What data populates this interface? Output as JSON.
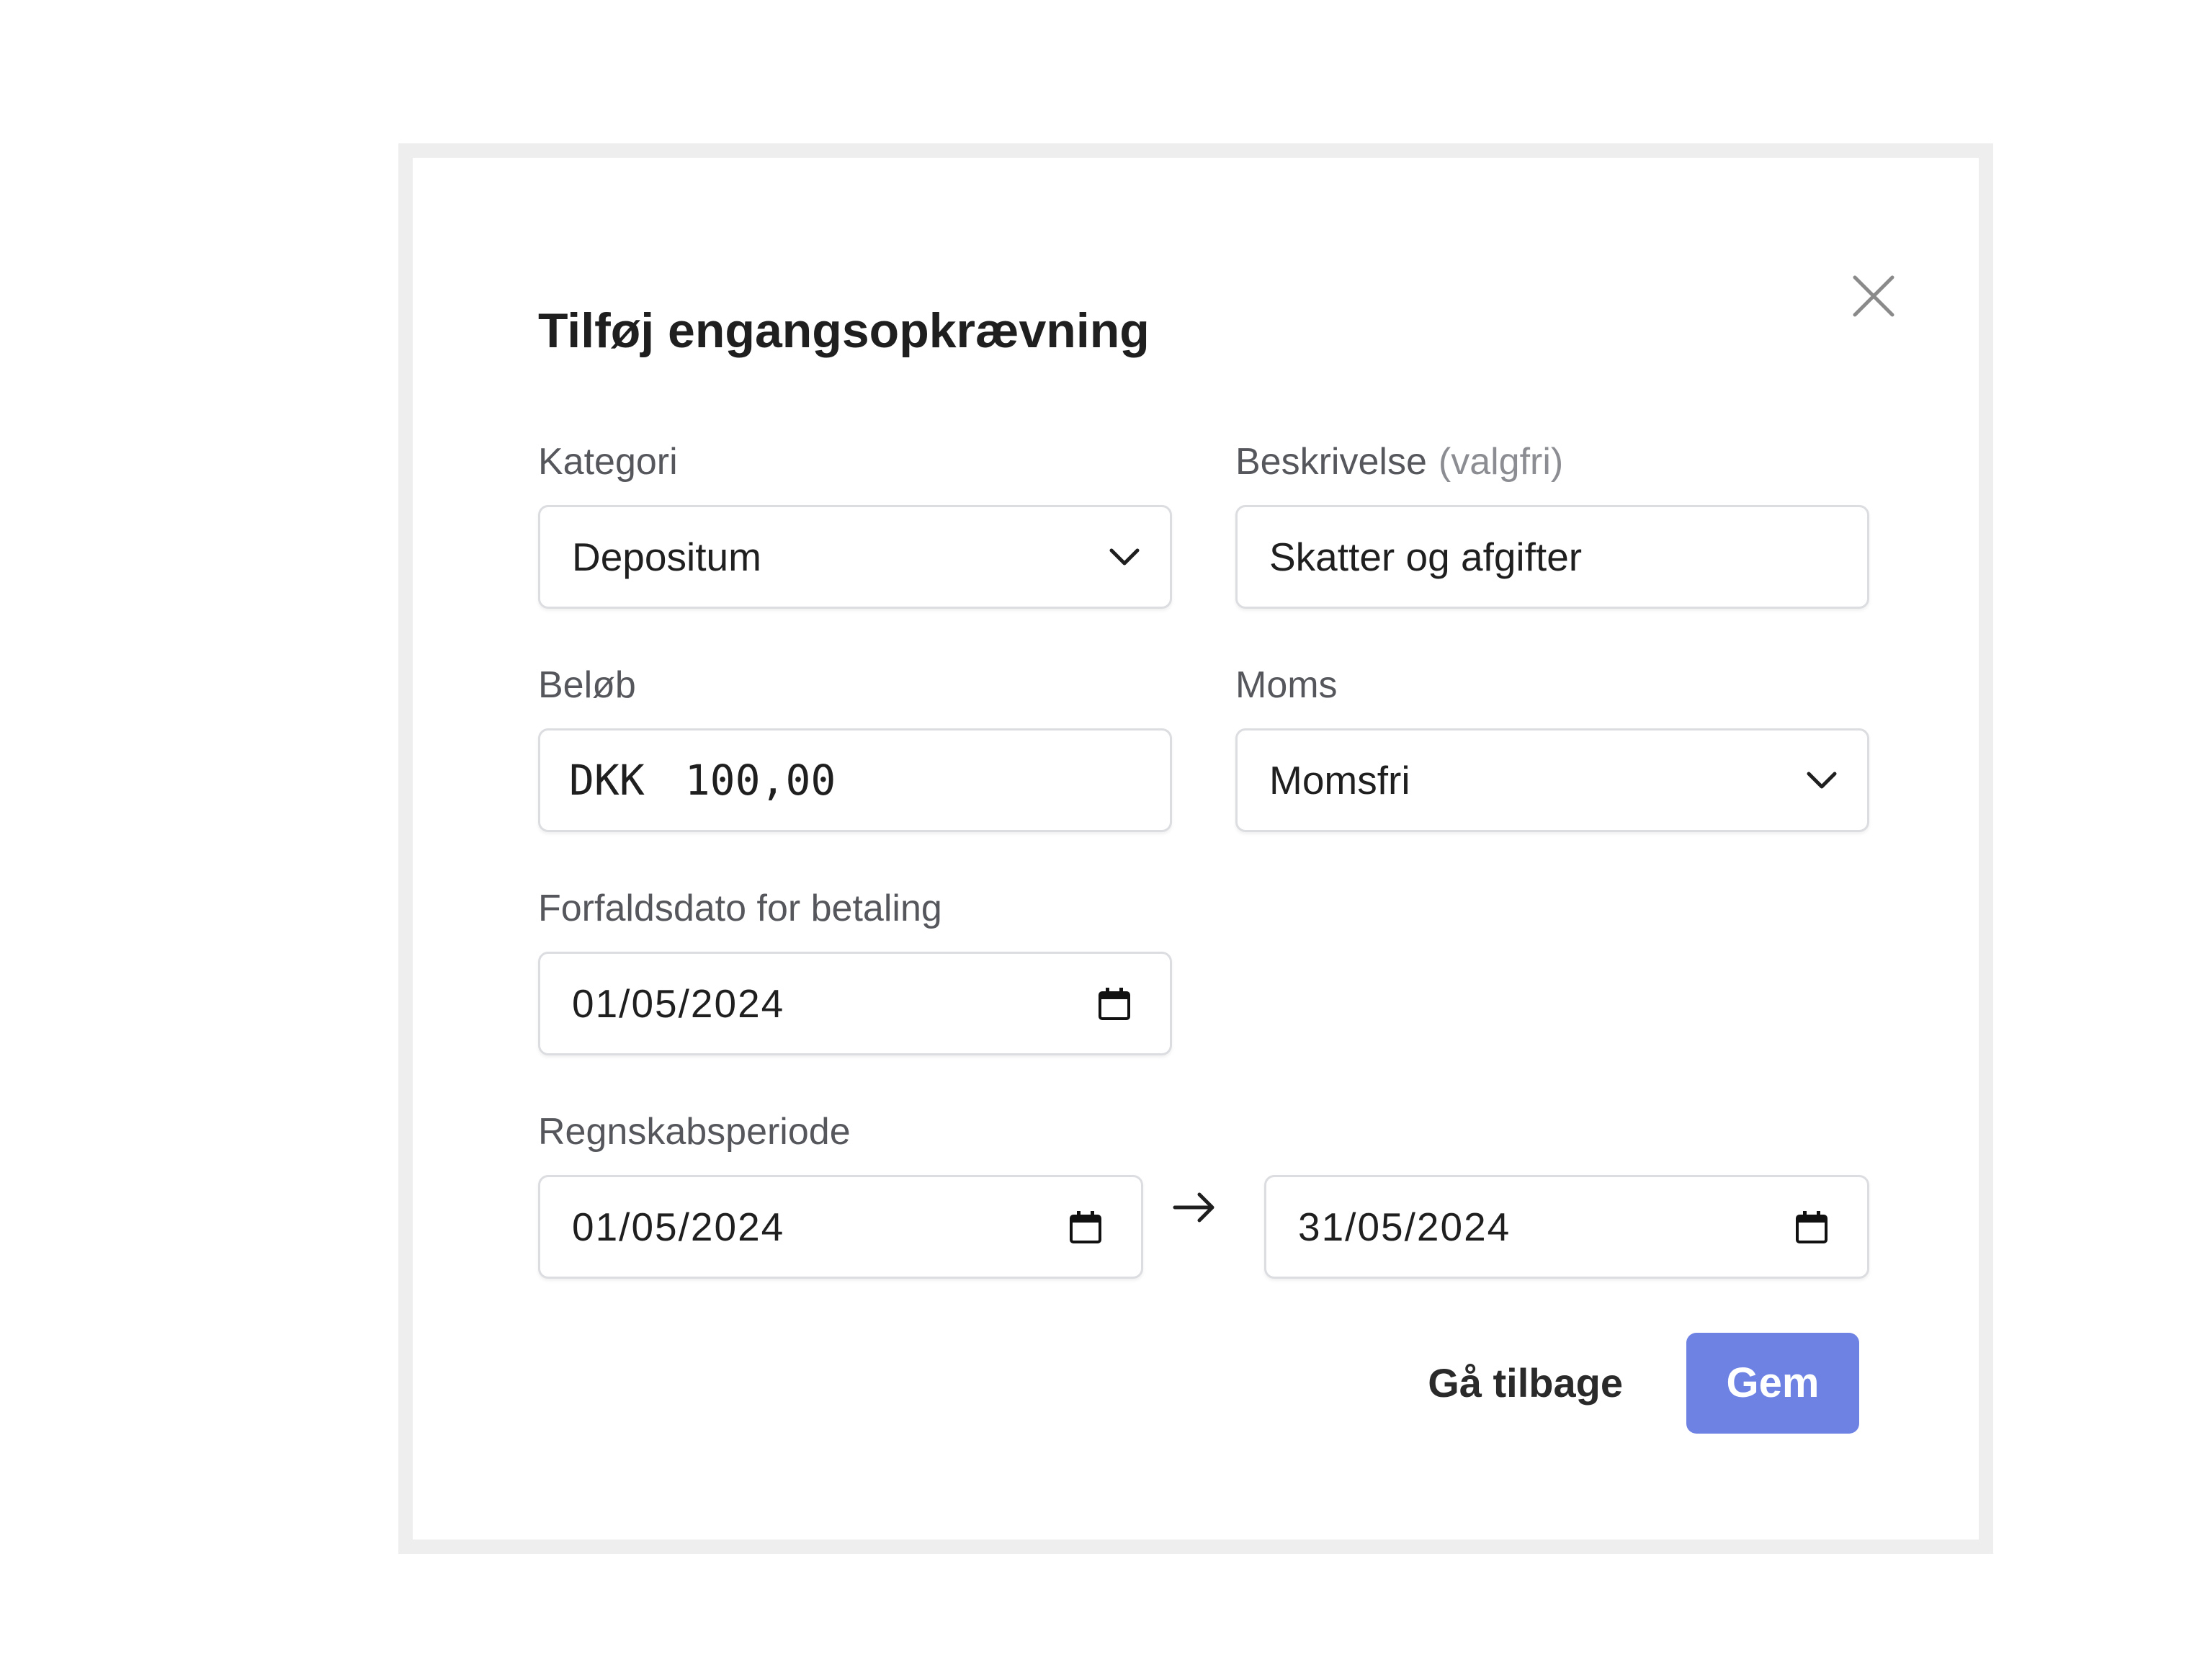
{
  "dialog": {
    "title": "Tilføj engangsopkrævning",
    "close_icon": "close-icon"
  },
  "form": {
    "category": {
      "label": "Kategori",
      "value": "Depositum",
      "icon": "chevron-down-icon"
    },
    "description": {
      "label": "Beskrivelse",
      "optional_hint": "(valgfri)",
      "value": "Skatter og afgifter"
    },
    "amount": {
      "label": "Beløb",
      "currency": "DKK",
      "value": "100,00"
    },
    "vat": {
      "label": "Moms",
      "value": "Momsfri",
      "icon": "chevron-down-icon"
    },
    "due_date": {
      "label": "Forfaldsdato for betaling",
      "value": "01/05/2024",
      "icon": "calendar-icon"
    },
    "accounting_period": {
      "label": "Regnskabsperiode",
      "start": "01/05/2024",
      "end": "31/05/2024",
      "separator_icon": "arrow-right-icon",
      "icon": "calendar-icon"
    }
  },
  "actions": {
    "back_label": "Gå tilbage",
    "save_label": "Gem"
  },
  "colors": {
    "primary_button": "#6e82e3",
    "field_border": "#dcdde0",
    "label_text": "#55575d",
    "frame_border": "#eeeeee"
  }
}
